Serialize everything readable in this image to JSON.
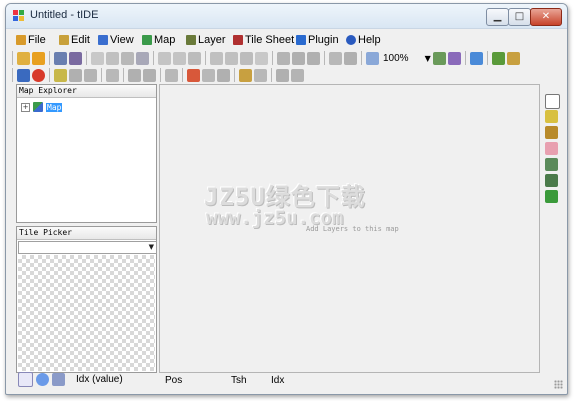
{
  "window": {
    "title": "Untitled - tIDE"
  },
  "menu": [
    {
      "label": "File",
      "icon": "file-icon",
      "color": "#d89a2a"
    },
    {
      "label": "Edit",
      "icon": "pencil-icon",
      "color": "#c8a03a"
    },
    {
      "label": "View",
      "icon": "view-icon",
      "color": "#3a6ecf"
    },
    {
      "label": "Map",
      "icon": "map-icon",
      "color": "#3a9a4a"
    },
    {
      "label": "Layer",
      "icon": "layer-icon",
      "color": "#6a7a3a"
    },
    {
      "label": "Tile Sheet",
      "icon": "tilesheet-icon",
      "color": "#b03030"
    },
    {
      "label": "Plugin",
      "icon": "plugin-icon",
      "color": "#2a6acf"
    },
    {
      "label": "Help",
      "icon": "help-icon",
      "color": "#2a5abf"
    }
  ],
  "toolbar": {
    "zoom_value": "100%"
  },
  "panels": {
    "map_explorer": {
      "title": "Map Explorer",
      "root_expander": "+",
      "root_label": "Map"
    },
    "tile_picker": {
      "title": "Tile Picker"
    }
  },
  "canvas": {
    "watermark_line1": "JZ5U绿色下载",
    "watermark_line2": "www.jz5u.com",
    "hint": "Add Layers to this map"
  },
  "tile_picker_status": {
    "label": "Idx  (value)"
  },
  "status": {
    "pos_label": "Pos",
    "tsh_label": "Tsh",
    "idx_label": "Idx"
  }
}
